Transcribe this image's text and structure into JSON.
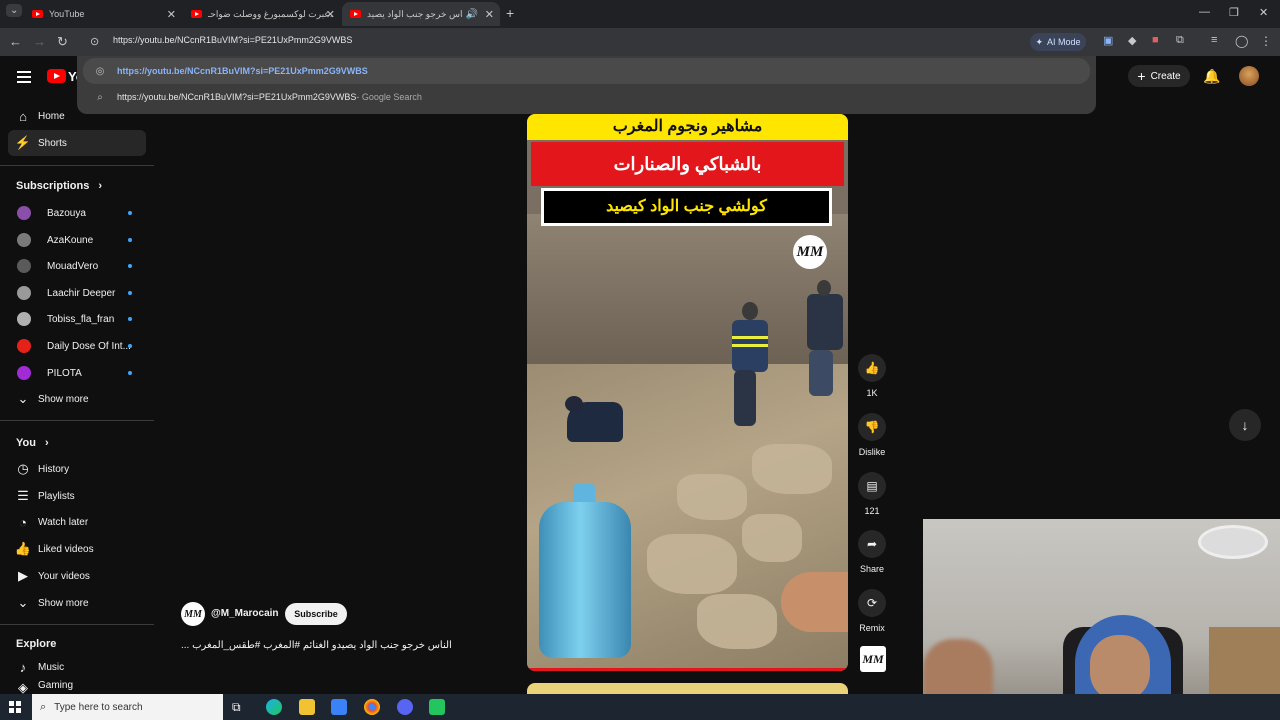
{
  "browser": {
    "tabs": [
      {
        "title": "YouTube"
      },
      {
        "title": "عبرت لوكسمبورغ ووصلت ضواحـ..."
      },
      {
        "title": "الناس خرجو جنب الواد يصيد..."
      }
    ],
    "address": "https://youtu.be/NCcnR1BuVIM?si=PE21UxPmm2G9VWBS",
    "ai_mode_label": "AI Mode",
    "suggestions": [
      {
        "text": "https://youtu.be/NCcnR1BuVIM?si=PE21UxPmm2G9VWBS",
        "suffix": ""
      },
      {
        "text": "https://youtu.be/NCcnR1BuVIM?si=PE21UxPmm2G9VWBS",
        "suffix": " - Google Search"
      }
    ]
  },
  "youtube": {
    "logo_text": "Yo",
    "create_label": "Create",
    "sidebar": {
      "primary": [
        {
          "label": "Home"
        },
        {
          "label": "Shorts"
        }
      ],
      "subscriptions_title": "Subscriptions",
      "subscriptions": [
        {
          "label": "Bazouya",
          "color": "#8a4fa8"
        },
        {
          "label": "AzaKoune",
          "color": "#7a7a7a"
        },
        {
          "label": "MouadVero",
          "color": "#5a5a5a"
        },
        {
          "label": "Laachir Deeper",
          "color": "#9a9a9a"
        },
        {
          "label": "Tobiss_fla_fran",
          "color": "#b0b0b0"
        },
        {
          "label": "Daily Dose Of Int...",
          "color": "#e62117"
        },
        {
          "label": "PILOTA",
          "color": "#a22bd6"
        }
      ],
      "show_more": "Show more",
      "you_title": "You",
      "you_items": [
        {
          "label": "History"
        },
        {
          "label": "Playlists"
        },
        {
          "label": "Watch later"
        },
        {
          "label": "Liked videos"
        },
        {
          "label": "Your videos"
        },
        {
          "label": "Show more"
        }
      ],
      "explore_title": "Explore",
      "explore_items": [
        {
          "label": "Music"
        },
        {
          "label": "Gaming"
        }
      ]
    },
    "short": {
      "overlay_line1": "مشاهير ونجوم المغرب",
      "overlay_line2": "بالشباكي والصنارات",
      "overlay_line3": "كولشي جنب الواد كيصيد",
      "watermark": "MM",
      "channel_handle": "@M_Marocain",
      "subscribe_label": "Subscribe",
      "caption": "الناس خرجو جنب الواد يصيدو الغنائم  #المغرب #طقس_المغرب ...",
      "actions": {
        "like_count": "1K",
        "dislike_label": "Dislike",
        "comment_count": "121",
        "share_label": "Share",
        "remix_label": "Remix"
      }
    }
  },
  "taskbar": {
    "search_placeholder": "Type here to search"
  }
}
